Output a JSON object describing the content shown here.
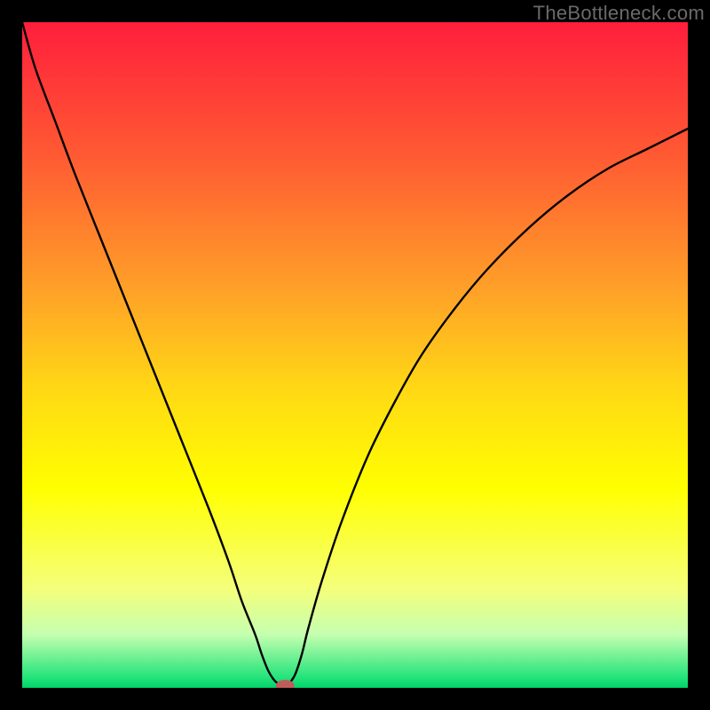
{
  "watermark": "TheBottleneck.com",
  "chart_data": {
    "type": "line",
    "title": "",
    "xlabel": "",
    "ylabel": "",
    "xlim": [
      0,
      100
    ],
    "ylim": [
      0,
      100
    ],
    "grid": false,
    "legend": false,
    "background_gradient": {
      "stops": [
        {
          "offset": 0.0,
          "color": "#ff1e3c"
        },
        {
          "offset": 0.2,
          "color": "#ff5a33"
        },
        {
          "offset": 0.4,
          "color": "#ffa028"
        },
        {
          "offset": 0.55,
          "color": "#ffd815"
        },
        {
          "offset": 0.7,
          "color": "#ffff00"
        },
        {
          "offset": 0.85,
          "color": "#f5ff7a"
        },
        {
          "offset": 0.92,
          "color": "#c5ffb0"
        },
        {
          "offset": 0.985,
          "color": "#22e37a"
        },
        {
          "offset": 1.0,
          "color": "#00d46a"
        }
      ]
    },
    "series": [
      {
        "name": "bottleneck-curve",
        "color": "#000000",
        "x": [
          0,
          2,
          5,
          8,
          12,
          16,
          20,
          24,
          28,
          31,
          33,
          35,
          36,
          37,
          38,
          39,
          39.5,
          40,
          41,
          42,
          43,
          45,
          48,
          52,
          56,
          60,
          65,
          70,
          76,
          82,
          88,
          94,
          100
        ],
        "y": [
          100,
          93,
          85,
          77,
          67,
          57,
          47,
          37,
          27,
          19,
          13,
          8,
          5,
          2.5,
          1,
          0.3,
          0.2,
          0.5,
          2,
          5,
          9,
          16,
          25,
          35,
          43,
          50,
          57,
          63,
          69,
          74,
          78,
          81,
          84
        ]
      }
    ],
    "marker": {
      "name": "bottleneck-point",
      "x": 39.5,
      "y": 0.3,
      "color": "#c05b5b",
      "rx": 1.4,
      "ry": 0.9
    }
  }
}
